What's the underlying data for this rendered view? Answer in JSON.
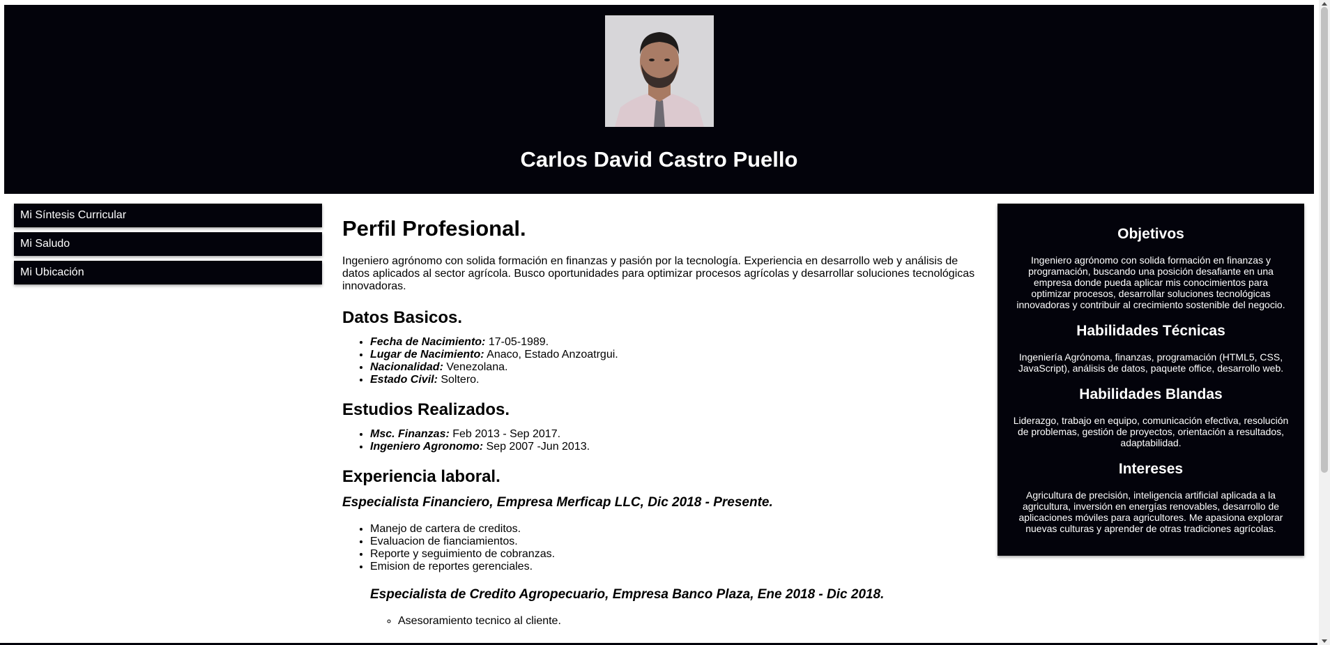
{
  "header": {
    "name": "Carlos David Castro Puello"
  },
  "nav": {
    "items": [
      {
        "label": "Mi Síntesis Curricular"
      },
      {
        "label": "Mi Saludo"
      },
      {
        "label": "Mi Ubicación"
      }
    ]
  },
  "main": {
    "profile_title": "Perfil Profesional.",
    "profile_text": "Ingeniero agrónomo con solida formación en finanzas y pasión por la tecnología. Experiencia en desarrollo web y análisis de datos aplicados al sector agrícola. Busco oportunidades para optimizar procesos agrícolas y desarrollar soluciones tecnológicas innovadoras.",
    "basics_title": "Datos Basicos.",
    "basics": [
      {
        "label": "Fecha de Nacimiento:",
        "value": " 17-05-1989."
      },
      {
        "label": "Lugar de Nacimiento:",
        "value": " Anaco, Estado Anzoatrgui."
      },
      {
        "label": "Nacionalidad:",
        "value": " Venezolana."
      },
      {
        "label": "Estado Civil:",
        "value": " Soltero."
      }
    ],
    "studies_title": "Estudios Realizados.",
    "studies": [
      {
        "label": "Msc. Finanzas:",
        "value": " Feb 2013 - Sep 2017."
      },
      {
        "label": "Ingeniero Agronomo:",
        "value": " Sep 2007 -Jun 2013."
      }
    ],
    "experience_title": "Experiencia laboral.",
    "job1": {
      "title": "Especialista Financiero, Empresa Merficap LLC, Dic 2018 - Presente.",
      "tasks": [
        "Manejo de cartera de creditos.",
        "Evaluacion de fianciamientos.",
        "Reporte y seguimiento de cobranzas.",
        "Emision de reportes gerenciales."
      ]
    },
    "job2": {
      "title": "Especialista de Credito Agropecuario, Empresa Banco Plaza, Ene 2018 - Dic 2018.",
      "tasks": [
        "Asesoramiento tecnico al cliente."
      ]
    }
  },
  "aside": {
    "objectives_title": "Objetivos",
    "objectives_text": "Ingeniero agrónomo con solida formación en finanzas y programación, buscando una posición desafiante en una empresa donde pueda aplicar mis conocimientos para optimizar procesos, desarrollar soluciones tecnológicas innovadoras y contribuir al crecimiento sostenible del negocio.",
    "tech_title": "Habilidades Técnicas",
    "tech_text": "Ingeniería Agrónoma, finanzas, programación (HTML5, CSS, JavaScript), análisis de datos, paquete office, desarrollo web.",
    "soft_title": "Habilidades Blandas",
    "soft_text": "Liderazgo, trabajo en equipo, comunicación efectiva, resolución de problemas, gestión de proyectos, orientación a resultados, adaptabilidad.",
    "interests_title": "Intereses",
    "interests_text": "Agricultura de precisión, inteligencia artificial aplicada a la agricultura, inversión en energías renovables, desarrollo de aplicaciones móviles para agricultores. Me apasiona explorar nuevas culturas y aprender de otras tradiciones agrícolas."
  },
  "colors": {
    "dark_bg": "#03030b",
    "text_light": "#ffffff",
    "page_bg": "#ffffff"
  }
}
